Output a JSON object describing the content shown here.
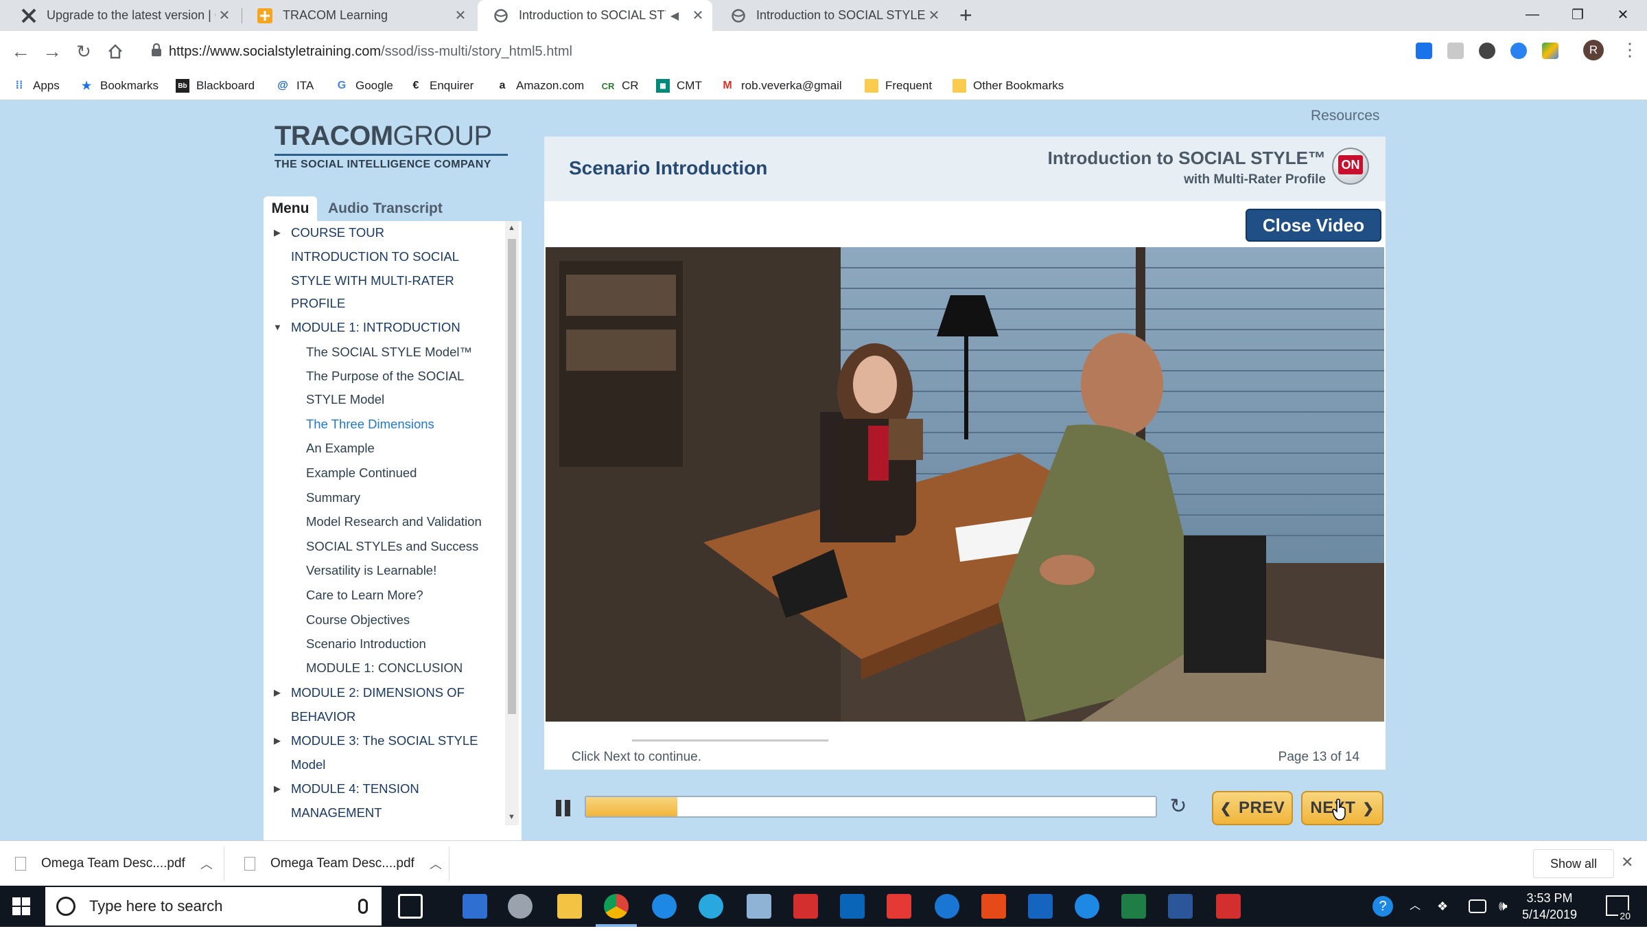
{
  "browser": {
    "tabs": [
      {
        "title": "Upgrade to the latest version | C",
        "active": false
      },
      {
        "title": "TRACOM Learning",
        "active": false
      },
      {
        "title": "Introduction to SOCIAL STYL",
        "active": true
      },
      {
        "title": "Introduction to SOCIAL STYLE wi",
        "active": false
      }
    ],
    "url_host": "https://www.socialstyletraining.com",
    "url_path": "/ssod/iss-multi/story_html5.html",
    "profile_initial": "R",
    "bookmarks": [
      "Apps",
      "Bookmarks",
      "Blackboard",
      "ITA",
      "Google",
      "Enquirer",
      "Amazon.com",
      "CR",
      "CMT",
      "rob.veverka@gmail",
      "Frequent",
      "Other Bookmarks"
    ]
  },
  "course": {
    "resources_label": "Resources",
    "logo_main": "TRACOM",
    "logo_group": "GROUP",
    "logo_tagline": "THE SOCIAL INTELLIGENCE COMPANY",
    "tab_menu": "Menu",
    "tab_audio": "Audio Transcript",
    "menu_items": [
      {
        "text": "COURSE TOUR",
        "level": 1,
        "toggle": "collapsed"
      },
      {
        "text": "INTRODUCTION TO SOCIAL",
        "level": 1,
        "toggle": "none"
      },
      {
        "text": "STYLE WITH MULTI-RATER",
        "level": 1,
        "toggle": "none"
      },
      {
        "text": "PROFILE",
        "level": 1,
        "toggle": "none"
      },
      {
        "text": "MODULE 1: INTRODUCTION",
        "level": 1,
        "toggle": "expanded"
      },
      {
        "text": "The SOCIAL STYLE Model™",
        "level": 2
      },
      {
        "text": "The Purpose of the SOCIAL",
        "level": 2
      },
      {
        "text": "STYLE Model",
        "level": 2
      },
      {
        "text": "The Three Dimensions",
        "level": 2,
        "state": "current"
      },
      {
        "text": "An Example",
        "level": 2
      },
      {
        "text": "Example Continued",
        "level": 2
      },
      {
        "text": "Summary",
        "level": 2
      },
      {
        "text": "Model Research and Validation",
        "level": 2
      },
      {
        "text": "SOCIAL STYLEs and Success",
        "level": 2
      },
      {
        "text": "Versatility is Learnable!",
        "level": 2
      },
      {
        "text": "Care to Learn More?",
        "level": 2
      },
      {
        "text": "Course Objectives",
        "level": 2
      },
      {
        "text": "Scenario Introduction",
        "level": 2,
        "state": "selected"
      },
      {
        "text": "MODULE 1: CONCLUSION",
        "level": 2
      },
      {
        "text": "MODULE 2: DIMENSIONS OF",
        "level": 1,
        "toggle": "collapsed"
      },
      {
        "text": "BEHAVIOR",
        "level": 1,
        "toggle": "none"
      },
      {
        "text": "MODULE 3: The SOCIAL STYLE",
        "level": 1,
        "toggle": "collapsed"
      },
      {
        "text": "Model",
        "level": 1,
        "toggle": "none"
      },
      {
        "text": "MODULE 4: TENSION",
        "level": 1,
        "toggle": "collapsed"
      },
      {
        "text": "MANAGEMENT",
        "level": 1,
        "toggle": "none"
      }
    ],
    "slide_title": "Scenario Introduction",
    "product_title": "Introduction to SOCIAL STYLE™",
    "product_subtitle": "with Multi-Rater Profile",
    "on_badge": "ON",
    "close_video_label": "Close Video",
    "click_next_text": "Click Next to continue.",
    "page_indicator": "Page 13 of 14",
    "playback_progress": 0.16,
    "prev_label": "PREV",
    "next_label": "NEXT"
  },
  "downloads": {
    "items": [
      "Omega Team Desc....pdf",
      "Omega Team Desc....pdf"
    ],
    "show_all_label": "Show all"
  },
  "taskbar": {
    "search_placeholder": "Type here to search",
    "time": "3:53 PM",
    "date": "5/14/2019",
    "notification_count": "20"
  },
  "colors": {
    "page_background": "#bddbf1",
    "slide_title": "#264a73",
    "nav_button": "#f2b53b",
    "close_video": "#1f4f85"
  }
}
